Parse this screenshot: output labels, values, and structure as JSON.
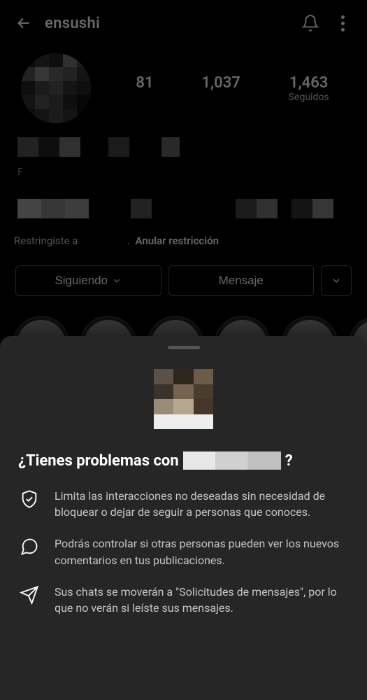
{
  "header": {
    "username": "ensushi"
  },
  "stats": {
    "posts": "81",
    "followers": "1,037",
    "following": "1,463",
    "following_label": "Seguidos"
  },
  "restrict": {
    "prefix": "Restringiste a",
    "undo_label": "Anular restricción"
  },
  "buttons": {
    "following": "Siguiendo",
    "message": "Mensaje"
  },
  "sheet": {
    "title_prefix": "¿Tienes problemas con",
    "title_suffix": "?",
    "rows": [
      {
        "text": "Limita las interacciones no deseadas sin necesidad de bloquear o dejar de seguir a personas que conoces."
      },
      {
        "text": "Podrás controlar si otras personas pueden ver los nuevos comentarios en tus publicaciones."
      },
      {
        "text": "Sus chats se moverán a \"Solicitudes de mensajes\", por lo que no verán si leíste sus mensajes."
      }
    ]
  }
}
